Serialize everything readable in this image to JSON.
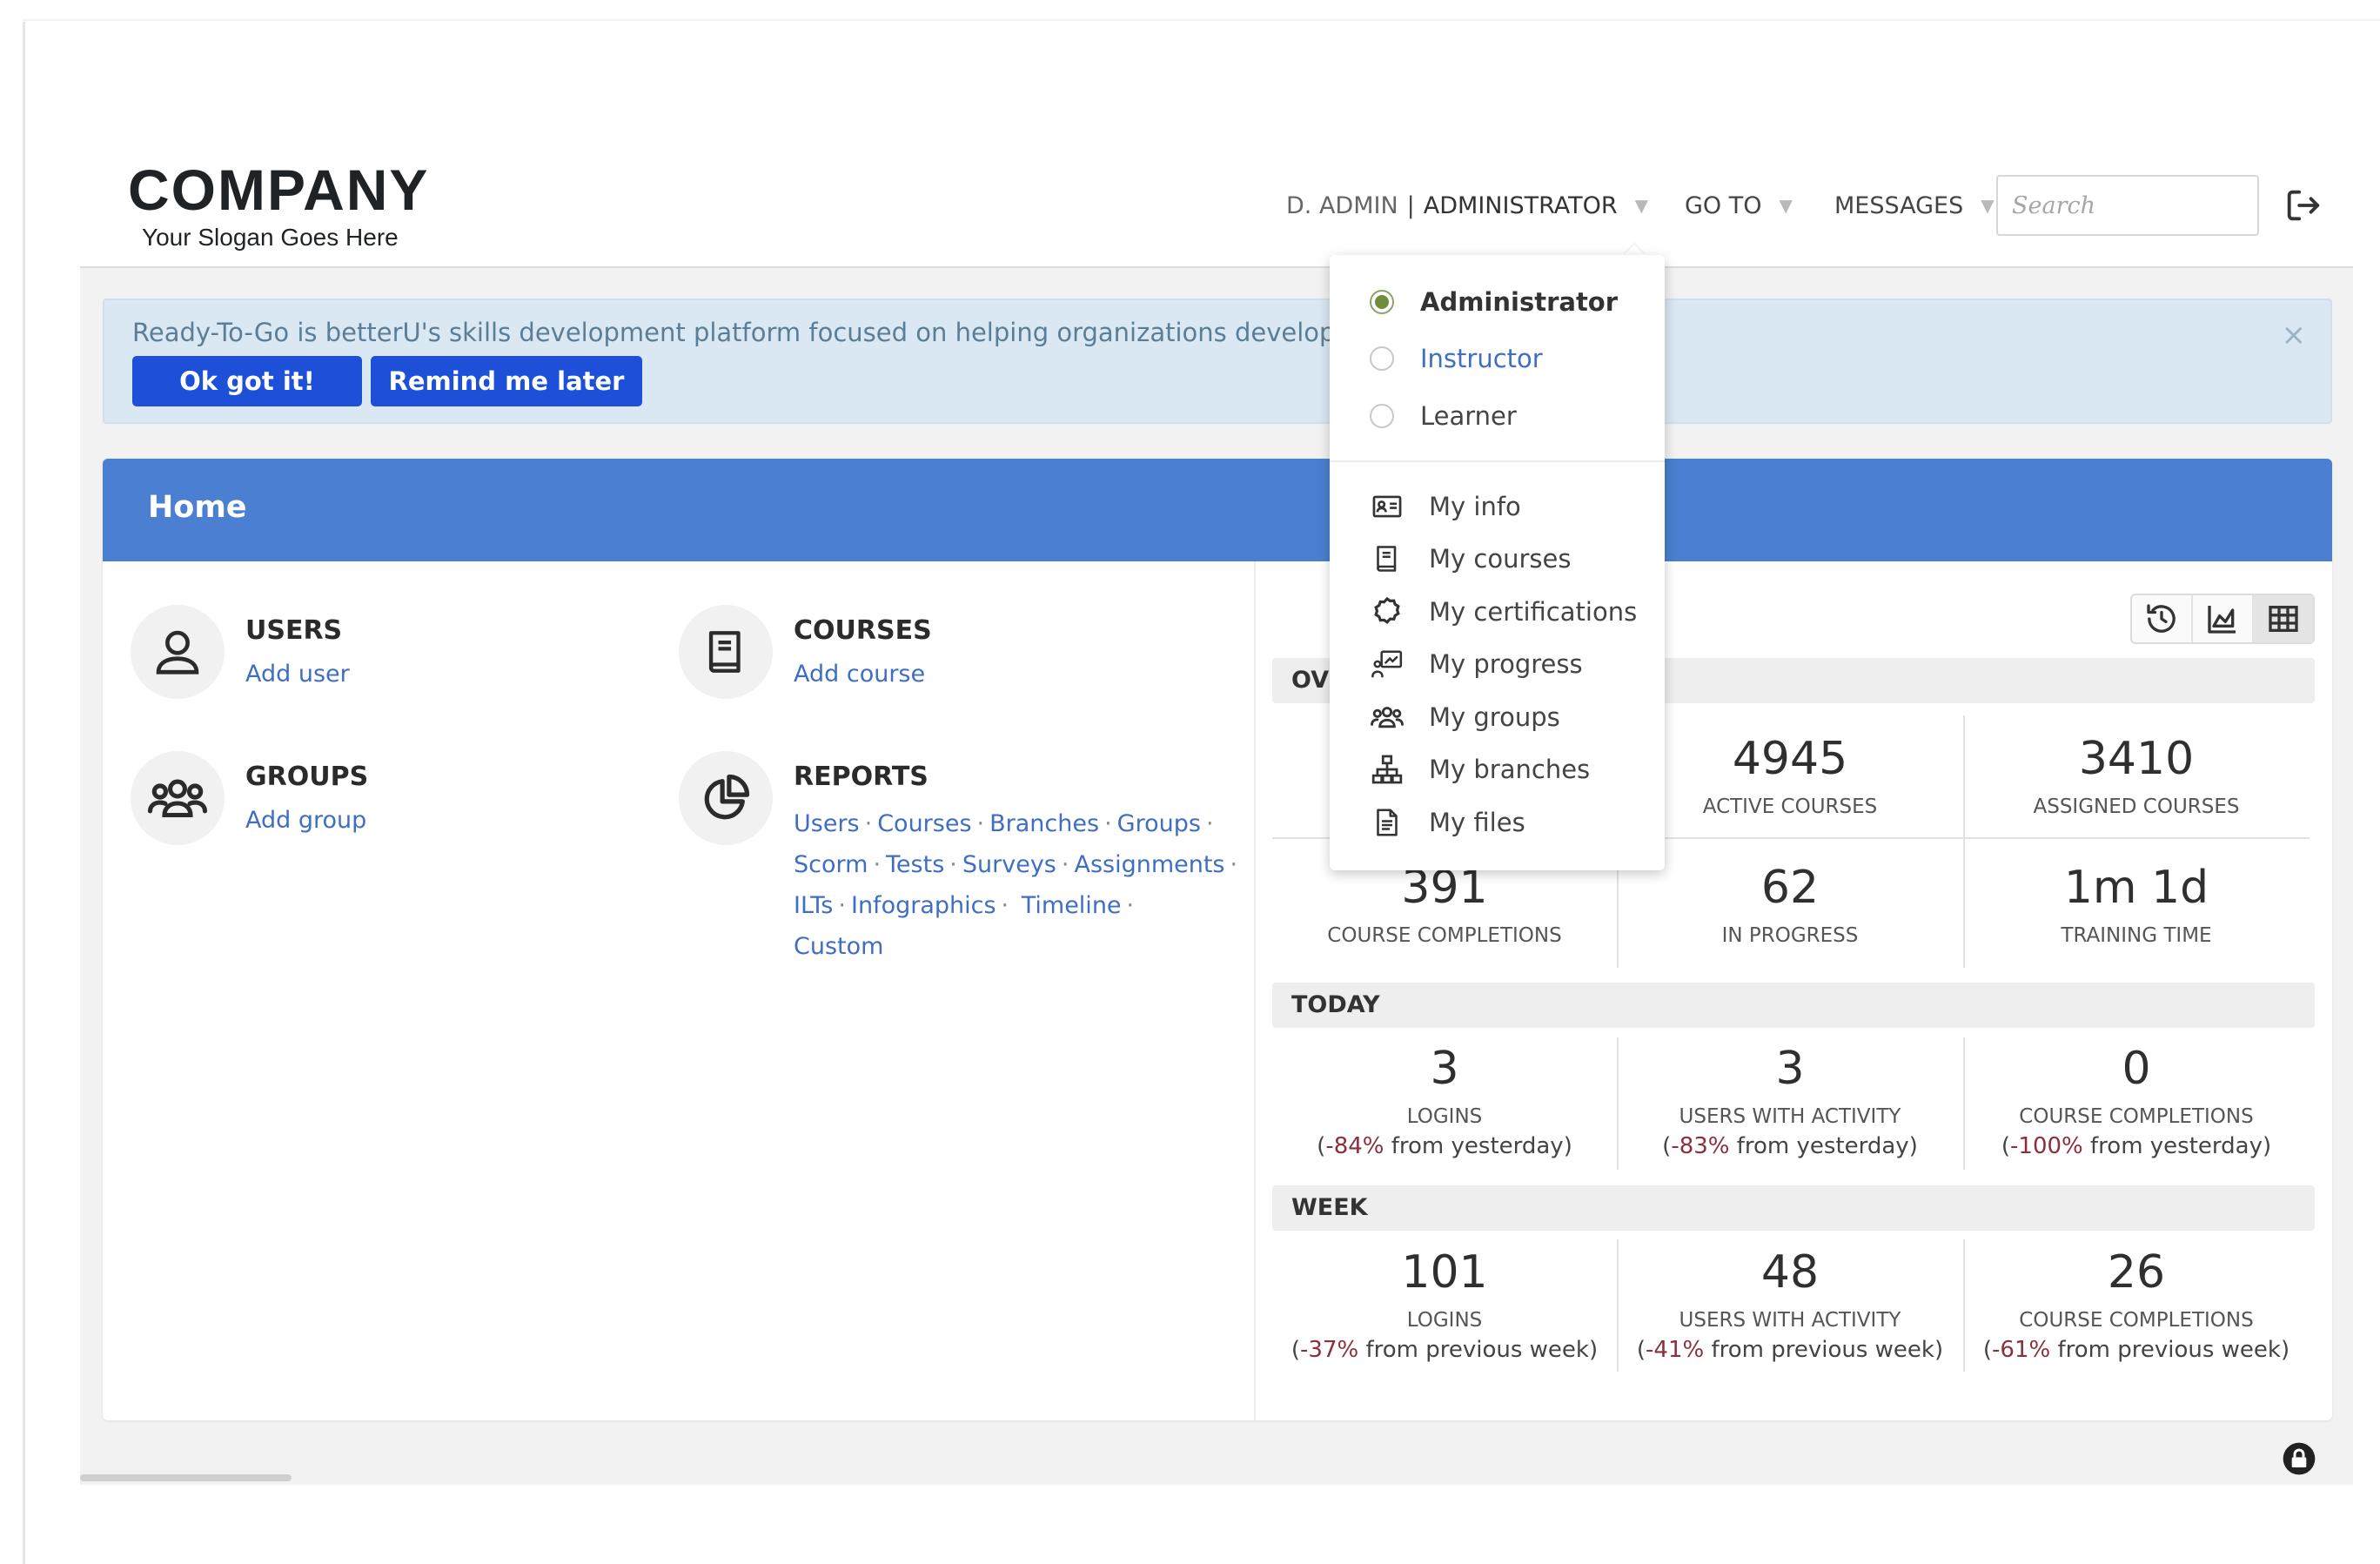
{
  "header": {
    "logo_name": "COMPANY",
    "logo_slogan": "Your Slogan Goes Here",
    "user_name": "D. ADMIN",
    "user_separator": "|",
    "user_role": "ADMINISTRATOR",
    "goto_label": "GO TO",
    "messages_label": "MESSAGES",
    "search_placeholder": "Search",
    "caret": "▼"
  },
  "banner": {
    "text": "Ready-To-Go is betterU's skills development platform focused on helping organizations develop and adv",
    "ok_label": "Ok got it!",
    "remind_label": "Remind me later",
    "close": "×"
  },
  "home": {
    "title": "Home",
    "users": {
      "title": "USERS",
      "link": "Add user"
    },
    "courses": {
      "title": "COURSES",
      "link": "Add course"
    },
    "groups": {
      "title": "GROUPS",
      "link": "Add group"
    },
    "reports": {
      "title": "REPORTS",
      "links": [
        "Users",
        "Courses",
        "Branches",
        "Groups",
        "Scorm",
        "Tests",
        "Surveys",
        "Assignments",
        "ILTs",
        "Infographics",
        "Timeline",
        "Custom"
      ]
    }
  },
  "stats": {
    "overview_label": "OVI",
    "overview": [
      {
        "value": "4945",
        "label": "ACTIVE COURSES"
      },
      {
        "value": "3410",
        "label": "ASSIGNED COURSES"
      },
      {
        "value": "391",
        "label": "COURSE COMPLETIONS"
      },
      {
        "value": "62",
        "label": "IN PROGRESS"
      },
      {
        "value": "1m 1d",
        "label": "TRAINING TIME"
      }
    ],
    "today_label": "TODAY",
    "today": [
      {
        "value": "3",
        "label": "LOGINS",
        "change_open": "(",
        "change_pct": "-84%",
        "change_rest": " from yesterday)"
      },
      {
        "value": "3",
        "label": "USERS WITH ACTIVITY",
        "change_open": "(",
        "change_pct": "-83%",
        "change_rest": " from yesterday)"
      },
      {
        "value": "0",
        "label": "COURSE COMPLETIONS",
        "change_open": "(",
        "change_pct": "-100%",
        "change_rest": " from yesterday)"
      }
    ],
    "week_label": "WEEK",
    "week": [
      {
        "value": "101",
        "label": "LOGINS",
        "change_open": "(",
        "change_pct": "-37%",
        "change_rest": " from previous week)"
      },
      {
        "value": "48",
        "label": "USERS WITH ACTIVITY",
        "change_open": "(",
        "change_pct": "-41%",
        "change_rest": " from previous week)"
      },
      {
        "value": "26",
        "label": "COURSE COMPLETIONS",
        "change_open": "(",
        "change_pct": "-61%",
        "change_rest": " from previous week)"
      }
    ]
  },
  "dropdown": {
    "roles": [
      {
        "label": "Administrator",
        "selected": true
      },
      {
        "label": "Instructor",
        "selected": false
      },
      {
        "label": "Learner",
        "selected": false
      }
    ],
    "items": [
      {
        "label": "My info",
        "icon": "id-card-icon"
      },
      {
        "label": "My courses",
        "icon": "book-icon"
      },
      {
        "label": "My certifications",
        "icon": "certificate-icon"
      },
      {
        "label": "My progress",
        "icon": "progress-icon"
      },
      {
        "label": "My groups",
        "icon": "group-icon"
      },
      {
        "label": "My branches",
        "icon": "branches-icon"
      },
      {
        "label": "My files",
        "icon": "file-icon"
      }
    ]
  },
  "colors": {
    "header_blue": "#4a7fd1",
    "button_blue": "#1d4fd8",
    "link_blue": "#3f6ec2",
    "negative_red": "#8b2f3f",
    "radio_green": "#6f8d3a"
  }
}
